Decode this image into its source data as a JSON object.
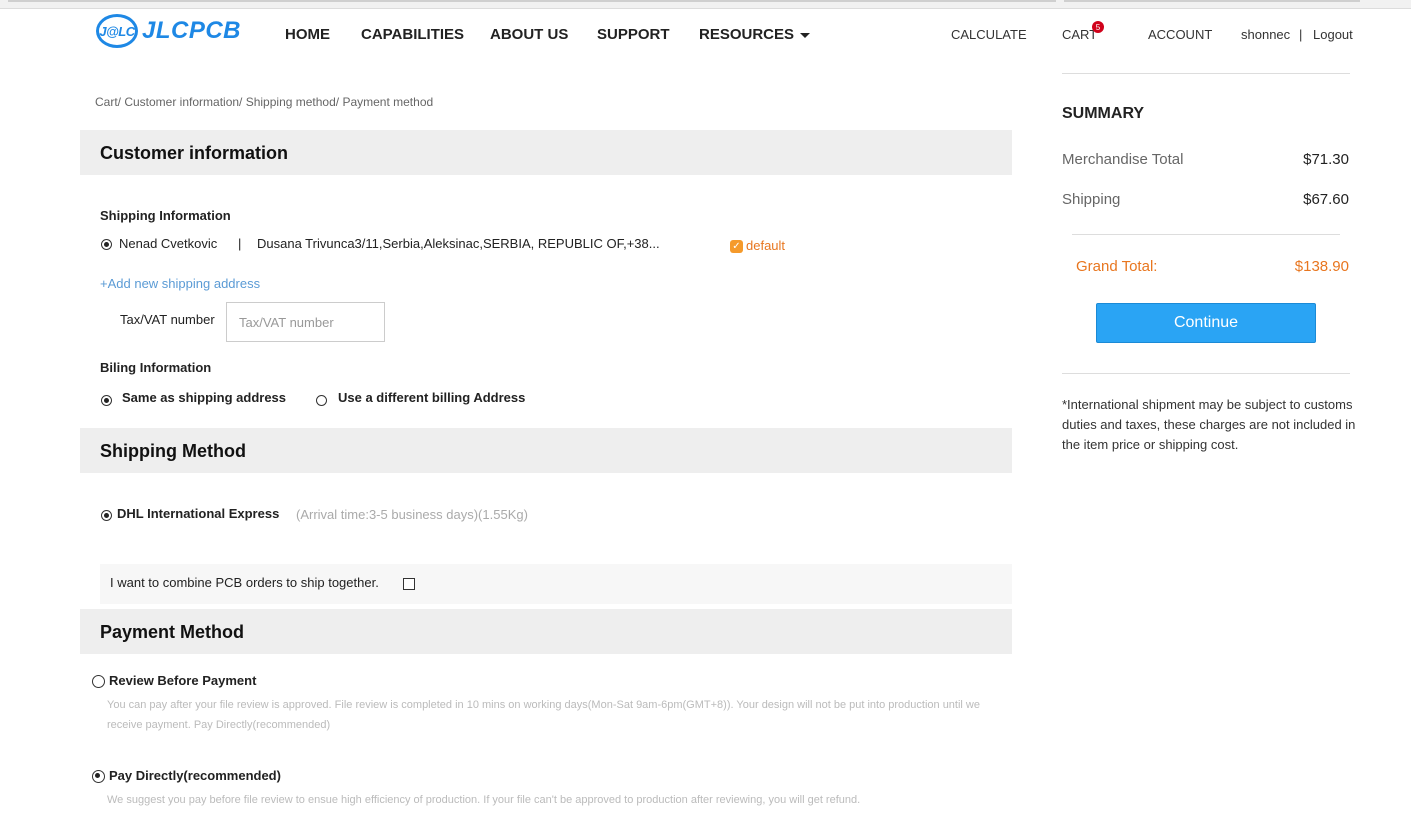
{
  "header": {
    "logo_badge": "J@LC",
    "logo_text": "JLCPCB",
    "nav": [
      "HOME",
      "CAPABILITIES",
      "ABOUT US",
      "SUPPORT",
      "RESOURCES"
    ],
    "calculate": "CALCULATE",
    "cart": "CART",
    "cart_count": "5",
    "account": "ACCOUNT",
    "username": "shonnec",
    "separator": "|",
    "logout": "Logout"
  },
  "breadcrumb": "Cart/ Customer information/ Shipping method/ Payment method",
  "customer": {
    "title": "Customer information",
    "shipping_label": "Shipping Information",
    "address_name": "Nenad Cvetkovic",
    "address_sep": "|",
    "address_text": "Dusana Trivunca3/11,Serbia,Aleksinac,SERBIA, REPUBLIC OF,+38...",
    "default_label": "default",
    "add_address": "+Add new shipping address",
    "tax_label": "Tax/VAT number",
    "tax_placeholder": "Tax/VAT number",
    "billing_label": "Biling Information",
    "billing_same": "Same as shipping address",
    "billing_diff": "Use a different billing Address"
  },
  "shipping": {
    "title": "Shipping Method",
    "method": "DHL International Express",
    "method_info": "(Arrival time:3-5 business days)(1.55Kg)",
    "combine": "I want to combine PCB orders to ship together."
  },
  "payment": {
    "title": "Payment Method",
    "review_label": "Review Before Payment",
    "review_desc": "You can pay after your file review is approved. File review is completed in 10 mins on working days(Mon-Sat 9am-6pm(GMT+8)). Your design will not be put into production until we receive payment. Pay Directly(recommended)",
    "direct_label": "Pay Directly(recommended)",
    "direct_desc": "We suggest you pay before file review to ensue high efficiency of production. If your file can't be approved to production after reviewing, you will get refund."
  },
  "summary": {
    "title": "SUMMARY",
    "merch_label": "Merchandise Total",
    "merch_value": "$71.30",
    "ship_label": "Shipping",
    "ship_value": "$67.60",
    "grand_label": "Grand Total:",
    "grand_value": "$138.90",
    "continue": "Continue",
    "note": "*International shipment may be subject to customs duties and taxes, these charges are not included in the item price or shipping cost."
  },
  "colors": {
    "brand": "#1e88e5",
    "accent_orange": "#e8761f",
    "button": "#2aa4f4"
  }
}
